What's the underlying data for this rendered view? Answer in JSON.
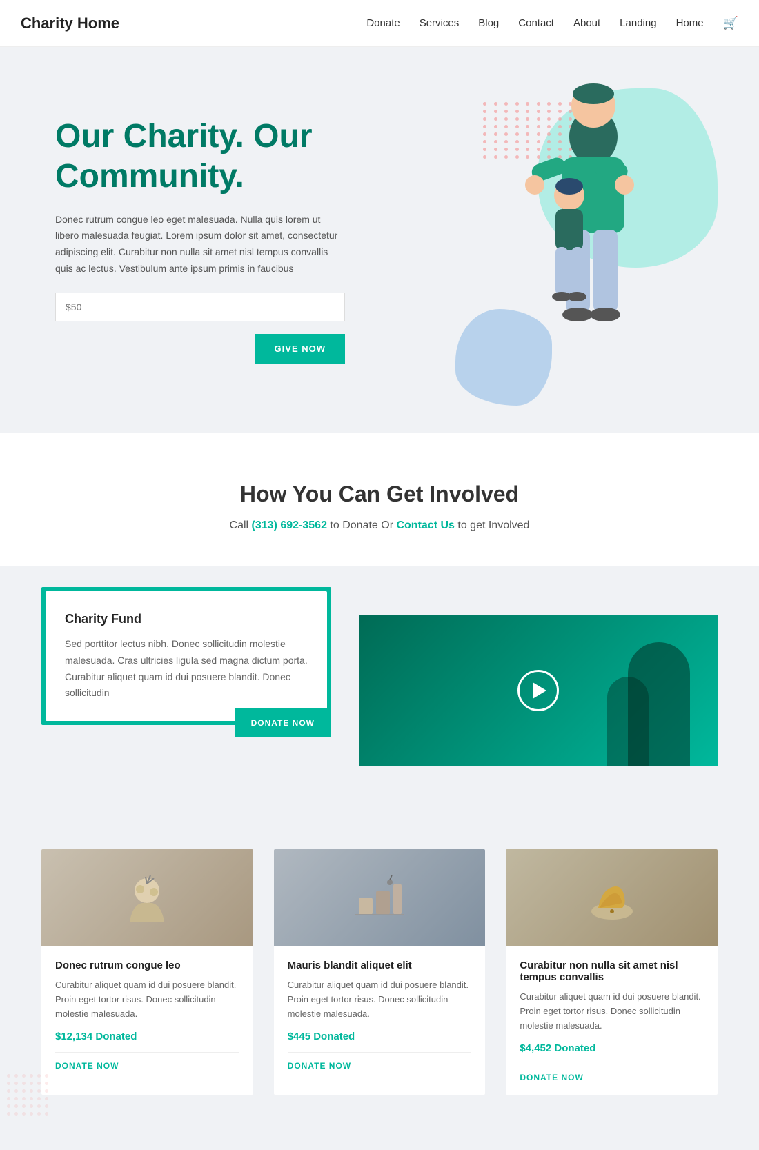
{
  "navbar": {
    "brand": "Charity Home",
    "links": [
      {
        "label": "Donate",
        "href": "#"
      },
      {
        "label": "Services",
        "href": "#"
      },
      {
        "label": "Blog",
        "href": "#"
      },
      {
        "label": "Contact",
        "href": "#"
      },
      {
        "label": "About",
        "href": "#"
      },
      {
        "label": "Landing",
        "href": "#"
      },
      {
        "label": "Home",
        "href": "#"
      }
    ]
  },
  "hero": {
    "title_line1": "Our Charity. Our",
    "title_line2": "Community.",
    "description": "Donec rutrum congue leo eget malesuada. Nulla quis lorem ut libero malesuada feugiat. Lorem ipsum dolor sit amet, consectetur adipiscing elit. Curabitur non nulla sit amet nisl tempus convallis quis ac lectus.  Vestibulum ante ipsum primis in faucibus",
    "input_placeholder": "$50",
    "give_now_label": "GIVE NOW"
  },
  "get_involved": {
    "title": "How You Can Get Involved",
    "description_prefix": "Call ",
    "phone": "(313) 692-3562",
    "description_middle": " to Donate Or ",
    "contact_link": "Contact Us",
    "description_suffix": " to get Involved"
  },
  "charity_fund": {
    "title": "Charity Fund",
    "description": "Sed porttitor lectus nibh. Donec sollicitudin molestie malesuada. Cras ultricies ligula sed magna dictum porta. Curabitur aliquet quam id dui posuere blandit. Donec sollicitudin",
    "donate_btn": "DONATE NOW"
  },
  "cards": [
    {
      "title": "Donec rutrum congue leo",
      "description": "Curabitur aliquet quam id dui posuere blandit. Proin eget tortor risus. Donec sollicitudin molestie malesuada.",
      "donated": "$12,134 Donated",
      "btn_label": "DONATE NOW"
    },
    {
      "title": "Mauris blandit aliquet elit",
      "description": "Curabitur aliquet quam id dui posuere blandit. Proin eget tortor risus. Donec sollicitudin molestie malesuada.",
      "donated": "$445 Donated",
      "btn_label": "DONATE NOW"
    },
    {
      "title": "Curabitur non nulla sit amet nisl tempus convallis",
      "description": "Curabitur aliquet quam id dui posuere blandit. Proin eget tortor risus. Donec sollicitudin molestie malesuada.",
      "donated": "$4,452 Donated",
      "btn_label": "DONATE NOW"
    }
  ],
  "colors": {
    "primary": "#00b89c",
    "dark_green": "#007a65",
    "text_dark": "#222",
    "text_muted": "#666"
  }
}
